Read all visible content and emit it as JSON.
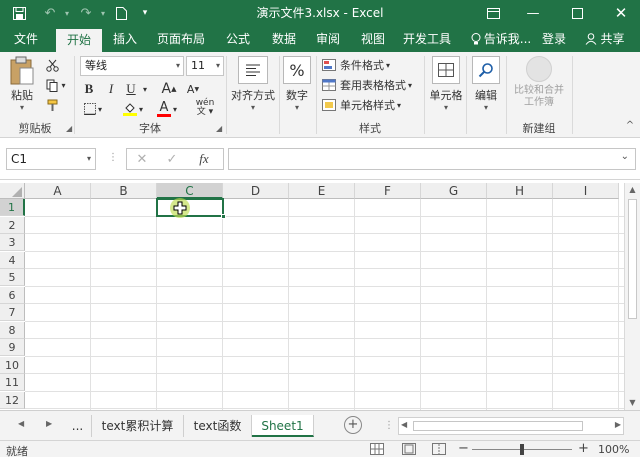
{
  "titlebar": {
    "title": "演示文件3.xlsx - Excel",
    "save_icon": "save-icon",
    "undo_icon": "undo-icon",
    "redo_icon": "redo-icon",
    "newfile_icon": "new-file-icon",
    "qa_more_icon": "customize-qat-icon",
    "ribbon_options_icon": "ribbon-display-options-icon",
    "minimize_icon": "minimize-icon",
    "restore_icon": "restore-icon",
    "close_icon": "close-icon",
    "brand_color": "#217346"
  },
  "tabs": [
    {
      "label": "文件"
    },
    {
      "label": "开始"
    },
    {
      "label": "插入"
    },
    {
      "label": "页面布局"
    },
    {
      "label": "公式"
    },
    {
      "label": "数据"
    },
    {
      "label": "审阅"
    },
    {
      "label": "视图"
    },
    {
      "label": "开发工具"
    }
  ],
  "tellme": "告诉我...",
  "login": "登录",
  "share": "共享",
  "ribbon": {
    "clipboard": {
      "paste": "粘贴",
      "label": "剪贴板"
    },
    "font": {
      "name": "等线",
      "size": "11",
      "bold": "B",
      "italic": "I",
      "underline": "U",
      "grow": "A",
      "shrink": "A",
      "font_color_letter": "A",
      "phonetic": "wén",
      "label": "字体",
      "fill_color": "#ffff00",
      "font_color": "#ff0000"
    },
    "alignment": {
      "label": "对齐方式"
    },
    "number": {
      "symbol": "%",
      "label": "数字"
    },
    "styles": {
      "conditional": "条件格式",
      "table": "套用表格格式",
      "cell": "单元格样式",
      "label": "样式"
    },
    "cells": {
      "label": "单元格"
    },
    "editing": {
      "label": "编辑"
    },
    "newgroup": {
      "compare": "比较和合并工作簿",
      "label": "新建组"
    }
  },
  "formula_bar": {
    "name_box": "C1",
    "cancel_icon": "cancel-icon",
    "enter_icon": "enter-icon",
    "fx": "fx",
    "value": ""
  },
  "grid": {
    "columns": [
      "A",
      "B",
      "C",
      "D",
      "E",
      "F",
      "G",
      "H",
      "I"
    ],
    "rows": [
      "1",
      "2",
      "3",
      "4",
      "5",
      "6",
      "7",
      "8",
      "9",
      "10",
      "11",
      "12"
    ],
    "selected_cell": "C1",
    "accent": "#217346"
  },
  "sheets": {
    "ellipsis": "...",
    "tabs": [
      {
        "label": "text累积计算"
      },
      {
        "label": "text函数"
      },
      {
        "label": "Sheet1"
      }
    ],
    "active": "Sheet1",
    "add_icon": "add-sheet-icon"
  },
  "status": {
    "mode": "就绪",
    "zoom_level": "100%",
    "zoom_minus": "−",
    "zoom_plus": "+"
  }
}
